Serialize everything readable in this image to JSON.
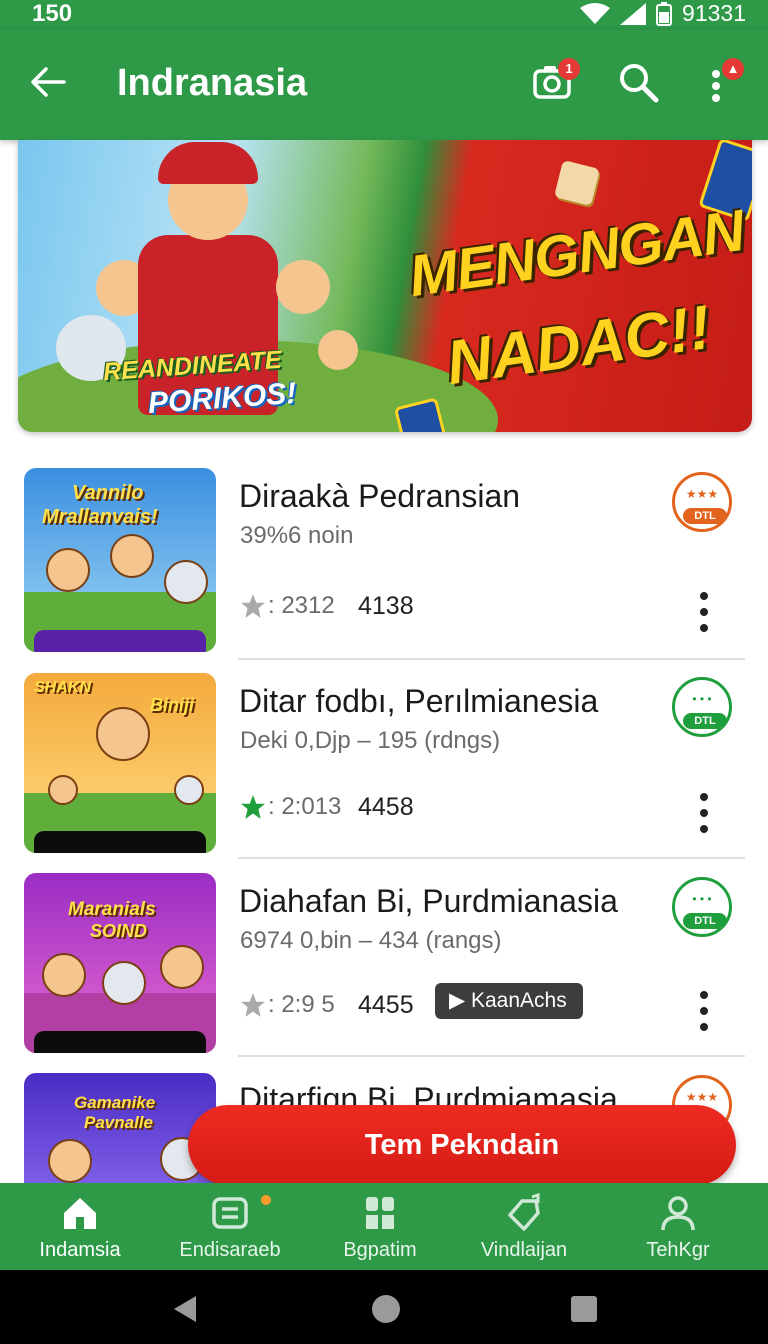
{
  "status": {
    "time": "150",
    "battery": "91331"
  },
  "appbar": {
    "title": "Indranasia",
    "camera_badge": "1",
    "icons": [
      "back-arrow-icon",
      "camera-icon",
      "search-icon",
      "more-vert-icon"
    ]
  },
  "banner": {
    "tag_line1": "REANDINEATE",
    "tag_line2": "PORIKOS!",
    "headline_line1": "MENGNGAN",
    "headline_line2": "NADAC!!"
  },
  "items": [
    {
      "thumb_line1": "Vannilo",
      "thumb_line2": "Mrallanvais!",
      "name": "Diraakà  Pedransian",
      "meta": "39%6 noin",
      "rating": ": 2312",
      "count": "4138",
      "star_color": "#a9a9a9",
      "badge_color": "#e2631d",
      "badge_label": "DTL"
    },
    {
      "thumb_line1": "SHAKN",
      "thumb_line2": "Biniji",
      "name": "Ditar fodbı, Perılmianesia",
      "meta": "Deki 0,Djp – 195 (rdngs)",
      "rating": ": 2:013",
      "count": "4458",
      "star_color": "#1f9e3c",
      "badge_color": "#1f9e3c",
      "badge_label": "DTL"
    },
    {
      "thumb_line1": "Maranials",
      "thumb_line2": "SOIND",
      "name": "Diahafan Bi, Purdmianasia",
      "meta": "6974 0,bin – 434 (rangs)",
      "rating": ": 2:9 5",
      "count": "4455",
      "star_color": "#a9a9a9",
      "badge_color": "#1f9e3c",
      "badge_label": "DTL",
      "chip": "KaanAchs"
    },
    {
      "thumb_line1": "Gamanike",
      "thumb_line2": "Pavnalle",
      "name": "Ditarfiqn Bi, Purdmiamasia",
      "badge_color": "#e2631d"
    }
  ],
  "fab": {
    "label": "Tem Pekndain"
  },
  "bottom_nav": [
    {
      "label": "Indamsia",
      "icon": "home-icon"
    },
    {
      "label": "Endisaraeb",
      "icon": "list-icon"
    },
    {
      "label": "Bgpatim",
      "icon": "grid-icon"
    },
    {
      "label": "Vindlaijan",
      "icon": "tag-icon"
    },
    {
      "label": "TehKgr",
      "icon": "profile-icon"
    }
  ],
  "colors": {
    "primary": "#2e9a48",
    "accent_red": "#e02019"
  }
}
